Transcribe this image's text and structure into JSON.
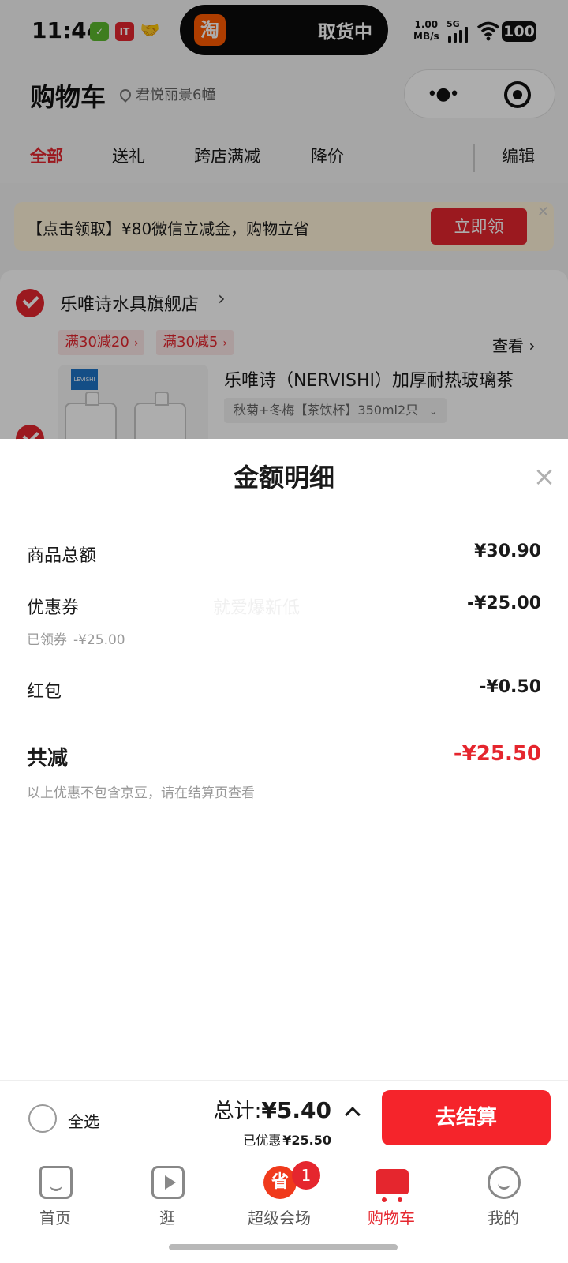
{
  "status_bar": {
    "time": "11:44",
    "island_app": "淘",
    "island_text": "取货中",
    "speed_value": "1.00",
    "speed_unit": "MB/s",
    "network": "5G",
    "battery": "100"
  },
  "header": {
    "title": "购物车",
    "location": "君悦丽景6幢",
    "tabs": [
      {
        "label": "全部",
        "active": true
      },
      {
        "label": "送礼",
        "active": false
      },
      {
        "label": "跨店满减",
        "active": false
      },
      {
        "label": "降价",
        "active": false
      }
    ],
    "edit_label": "编辑"
  },
  "promo": {
    "text": "【点击领取】¥80微信立减金，购物立省",
    "button": "立即领"
  },
  "store": {
    "name": "乐唯诗水具旗舰店",
    "coupons": [
      "满30减20",
      "满30减5"
    ],
    "view_more": "查看",
    "product": {
      "title": "乐唯诗（NERVISHI）加厚耐热玻璃茶",
      "spec": "秋菊+冬梅【茶饮杯】350ml2只"
    }
  },
  "detail_sheet": {
    "title": "金额明细",
    "watermark": "就爱爆新低",
    "rows": [
      {
        "label": "商品总额",
        "value": "¥30.90"
      },
      {
        "label": "优惠券",
        "value": "-¥25.00",
        "sub_label": "已领券",
        "sub_value": "-¥25.00"
      },
      {
        "label": "红包",
        "value": "-¥0.50"
      }
    ],
    "total": {
      "label": "共减",
      "value": "-¥25.50"
    },
    "note": "以上优惠不包含京豆，请在结算页查看"
  },
  "checkout": {
    "select_all": "全选",
    "total_label": "总计:",
    "total_amount": "¥5.40",
    "saved_label": "已优惠",
    "saved_amount": "¥25.50",
    "button": "去结算"
  },
  "tabbar": {
    "items": [
      {
        "label": "首页",
        "icon": "home-icon"
      },
      {
        "label": "逛",
        "icon": "video-icon"
      },
      {
        "label": "超级会场",
        "icon": "super-venue-icon",
        "badge": "1"
      },
      {
        "label": "购物车",
        "icon": "cart-icon",
        "active": true
      },
      {
        "label": "我的",
        "icon": "face-icon"
      }
    ]
  },
  "colors": {
    "accent": "#e5262e",
    "overlay": "rgba(0,0,0,0.32)"
  }
}
